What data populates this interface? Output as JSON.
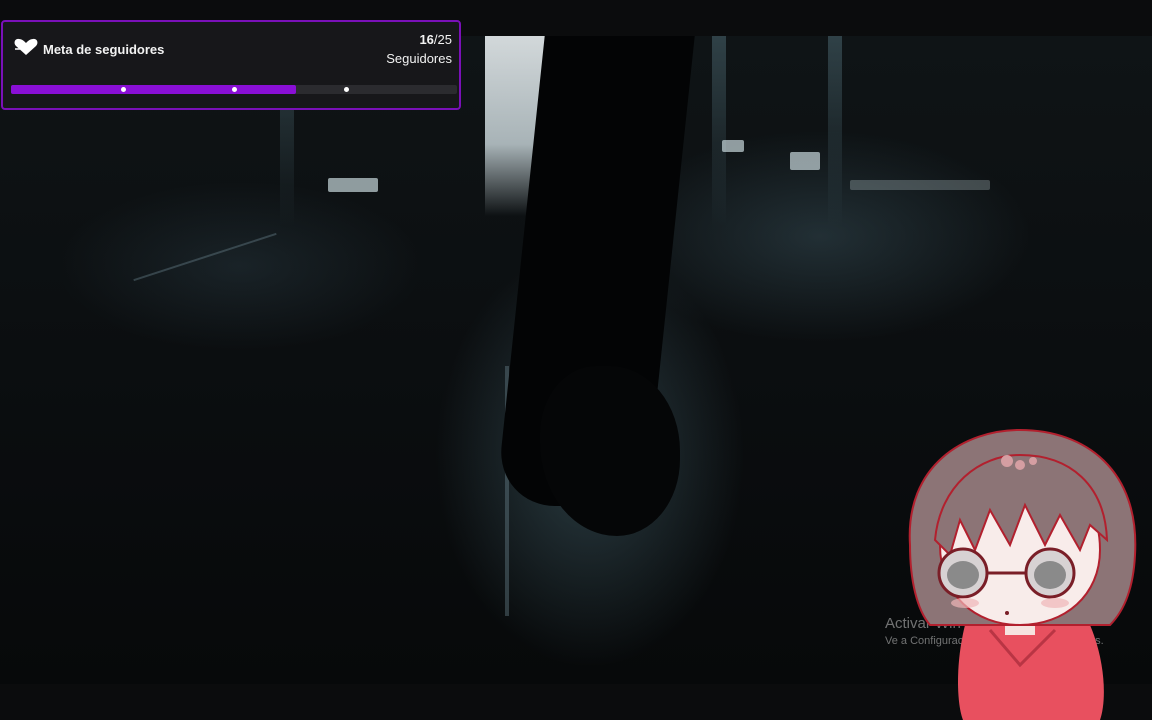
{
  "goal_widget": {
    "title": "Meta de seguidores",
    "current": "16",
    "separator": "/",
    "target": "25",
    "unit": "Seguidores",
    "progress_fraction": 0.64,
    "accent_color": "#8a0fd6",
    "icon": "heart-icon"
  },
  "watermark": {
    "title": "Activar Win",
    "subtitle_left": "Ve a Configuració",
    "subtitle_right": "dows."
  },
  "avatar": {
    "name": "anime-avatar"
  }
}
